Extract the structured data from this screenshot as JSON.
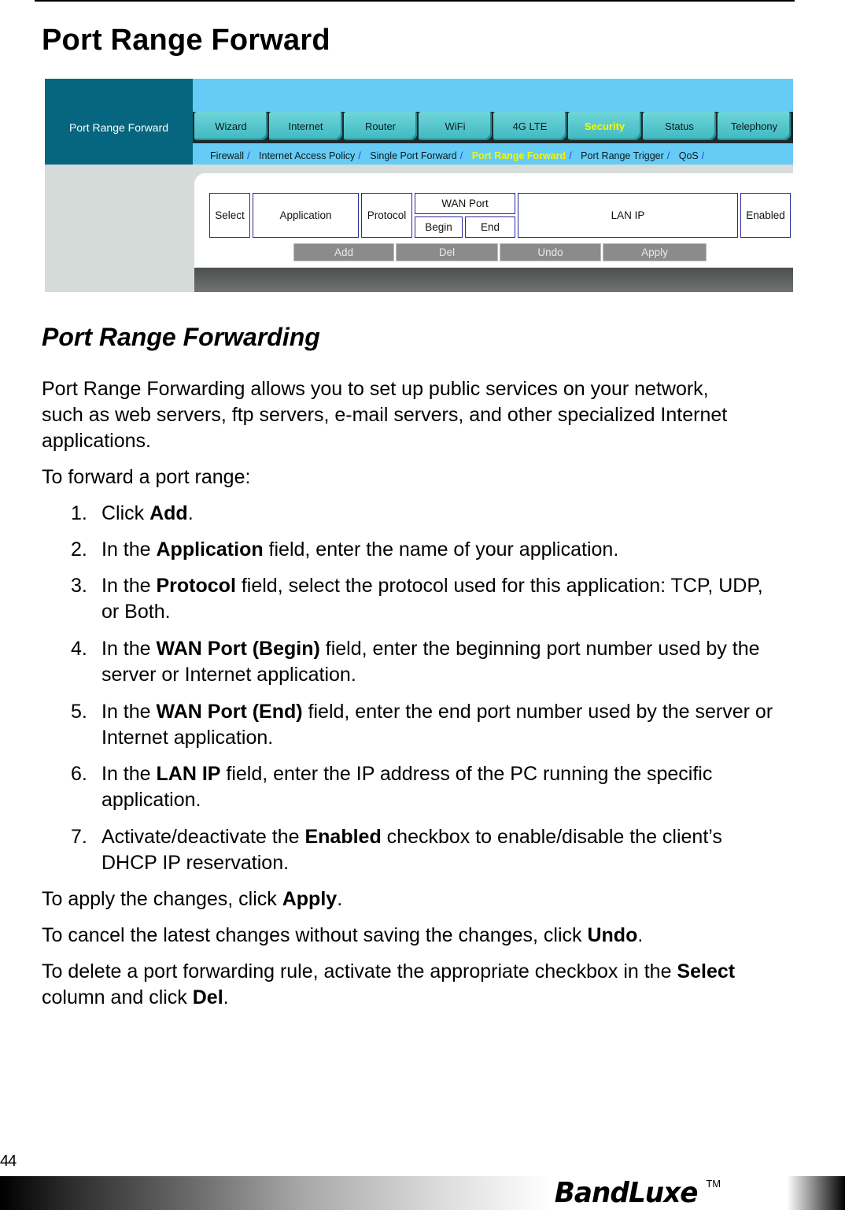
{
  "page": {
    "title": "Port Range Forward",
    "page_number": "44"
  },
  "screenshot": {
    "brand_label": "Port Range Forward",
    "tabs": [
      {
        "label": "Wizard",
        "active": false
      },
      {
        "label": "Internet",
        "active": false
      },
      {
        "label": "Router",
        "active": false
      },
      {
        "label": "WiFi",
        "active": false
      },
      {
        "label": "4G LTE",
        "active": false
      },
      {
        "label": "Security",
        "active": true
      },
      {
        "label": "Status",
        "active": false
      },
      {
        "label": "Telephony",
        "active": false
      }
    ],
    "subnav": [
      {
        "label": "Firewall",
        "active": false
      },
      {
        "label": "Internet Access Policy",
        "active": false
      },
      {
        "label": "Single Port Forward",
        "active": false
      },
      {
        "label": "Port Range Forward",
        "active": true
      },
      {
        "label": "Port Range Trigger",
        "active": false
      },
      {
        "label": "QoS",
        "active": false
      }
    ],
    "subnav_separator": "/",
    "table_headers": {
      "select": "Select",
      "application": "Application",
      "protocol": "Protocol",
      "wan_port": "WAN Port",
      "begin": "Begin",
      "end": "End",
      "lan_ip": "LAN IP",
      "enabled": "Enabled"
    },
    "buttons": {
      "add": "Add",
      "del": "Del",
      "undo": "Undo",
      "apply": "Apply"
    },
    "colors": {
      "brand_block": "#06667f",
      "nav_bg": "#66ccf5",
      "tab": "#4cc4cb",
      "active_text": "#f4f400",
      "header_border": "#28289a",
      "button": "#8a8c8a"
    }
  },
  "section": {
    "title": "Port Range Forwarding",
    "intro": "Port Range Forwarding allows you to set up public services on your network, such as web servers, ftp servers, e-mail servers, and other specialized Internet applications.",
    "lead": "To forward a port range:"
  },
  "steps": [
    {
      "num": "1.",
      "pre": "Click ",
      "bold": "Add",
      "post": "."
    },
    {
      "num": "2.",
      "pre": "In the ",
      "bold": "Application",
      "post": " field, enter the name of your application."
    },
    {
      "num": "3.",
      "pre": "In the ",
      "bold": "Protocol",
      "post": " field, select the protocol used for this application: TCP, UDP, or Both."
    },
    {
      "num": "4.",
      "pre": "In the ",
      "bold": "WAN Port (Begin)",
      "post": " field, enter the beginning port number used by the server or Internet application."
    },
    {
      "num": "5.",
      "pre": "In the ",
      "bold": "WAN Port (End)",
      "post": " field, enter the end port number used by the server or Internet application."
    },
    {
      "num": "6.",
      "pre": "In the ",
      "bold": "LAN IP",
      "post": " field, enter the IP address of the PC running the specific application."
    },
    {
      "num": "7.",
      "pre": "Activate/deactivate the ",
      "bold": "Enabled",
      "post": " checkbox to enable/disable the client’s DHCP IP reservation."
    }
  ],
  "notes": {
    "apply": {
      "pre": "To apply the changes, click ",
      "bold": "Apply",
      "post": "."
    },
    "undo": {
      "pre": "To cancel the latest changes without saving the changes, click ",
      "bold": "Undo",
      "post": "."
    },
    "delete": {
      "pre": "To delete a port forwarding rule, activate the appropriate checkbox in the ",
      "bold1": "Select",
      "mid": " column and click ",
      "bold2": "Del",
      "post": "."
    }
  },
  "footer": {
    "logo": "BandLuxe",
    "trademark": "TM"
  }
}
